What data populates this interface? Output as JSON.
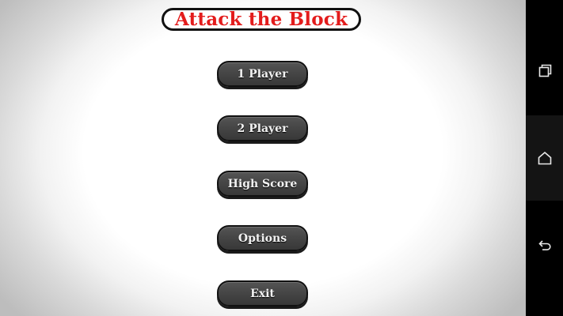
{
  "game": {
    "title": "Attack the Block",
    "title_color": "#e31c1c",
    "menu": [
      {
        "label": "1 Player"
      },
      {
        "label": "2 Player"
      },
      {
        "label": "High Score"
      },
      {
        "label": "Options"
      },
      {
        "label": "Exit"
      }
    ]
  },
  "system_nav": {
    "buttons": [
      {
        "icon": "recent-apps-icon"
      },
      {
        "icon": "home-icon"
      },
      {
        "icon": "back-icon"
      }
    ]
  }
}
